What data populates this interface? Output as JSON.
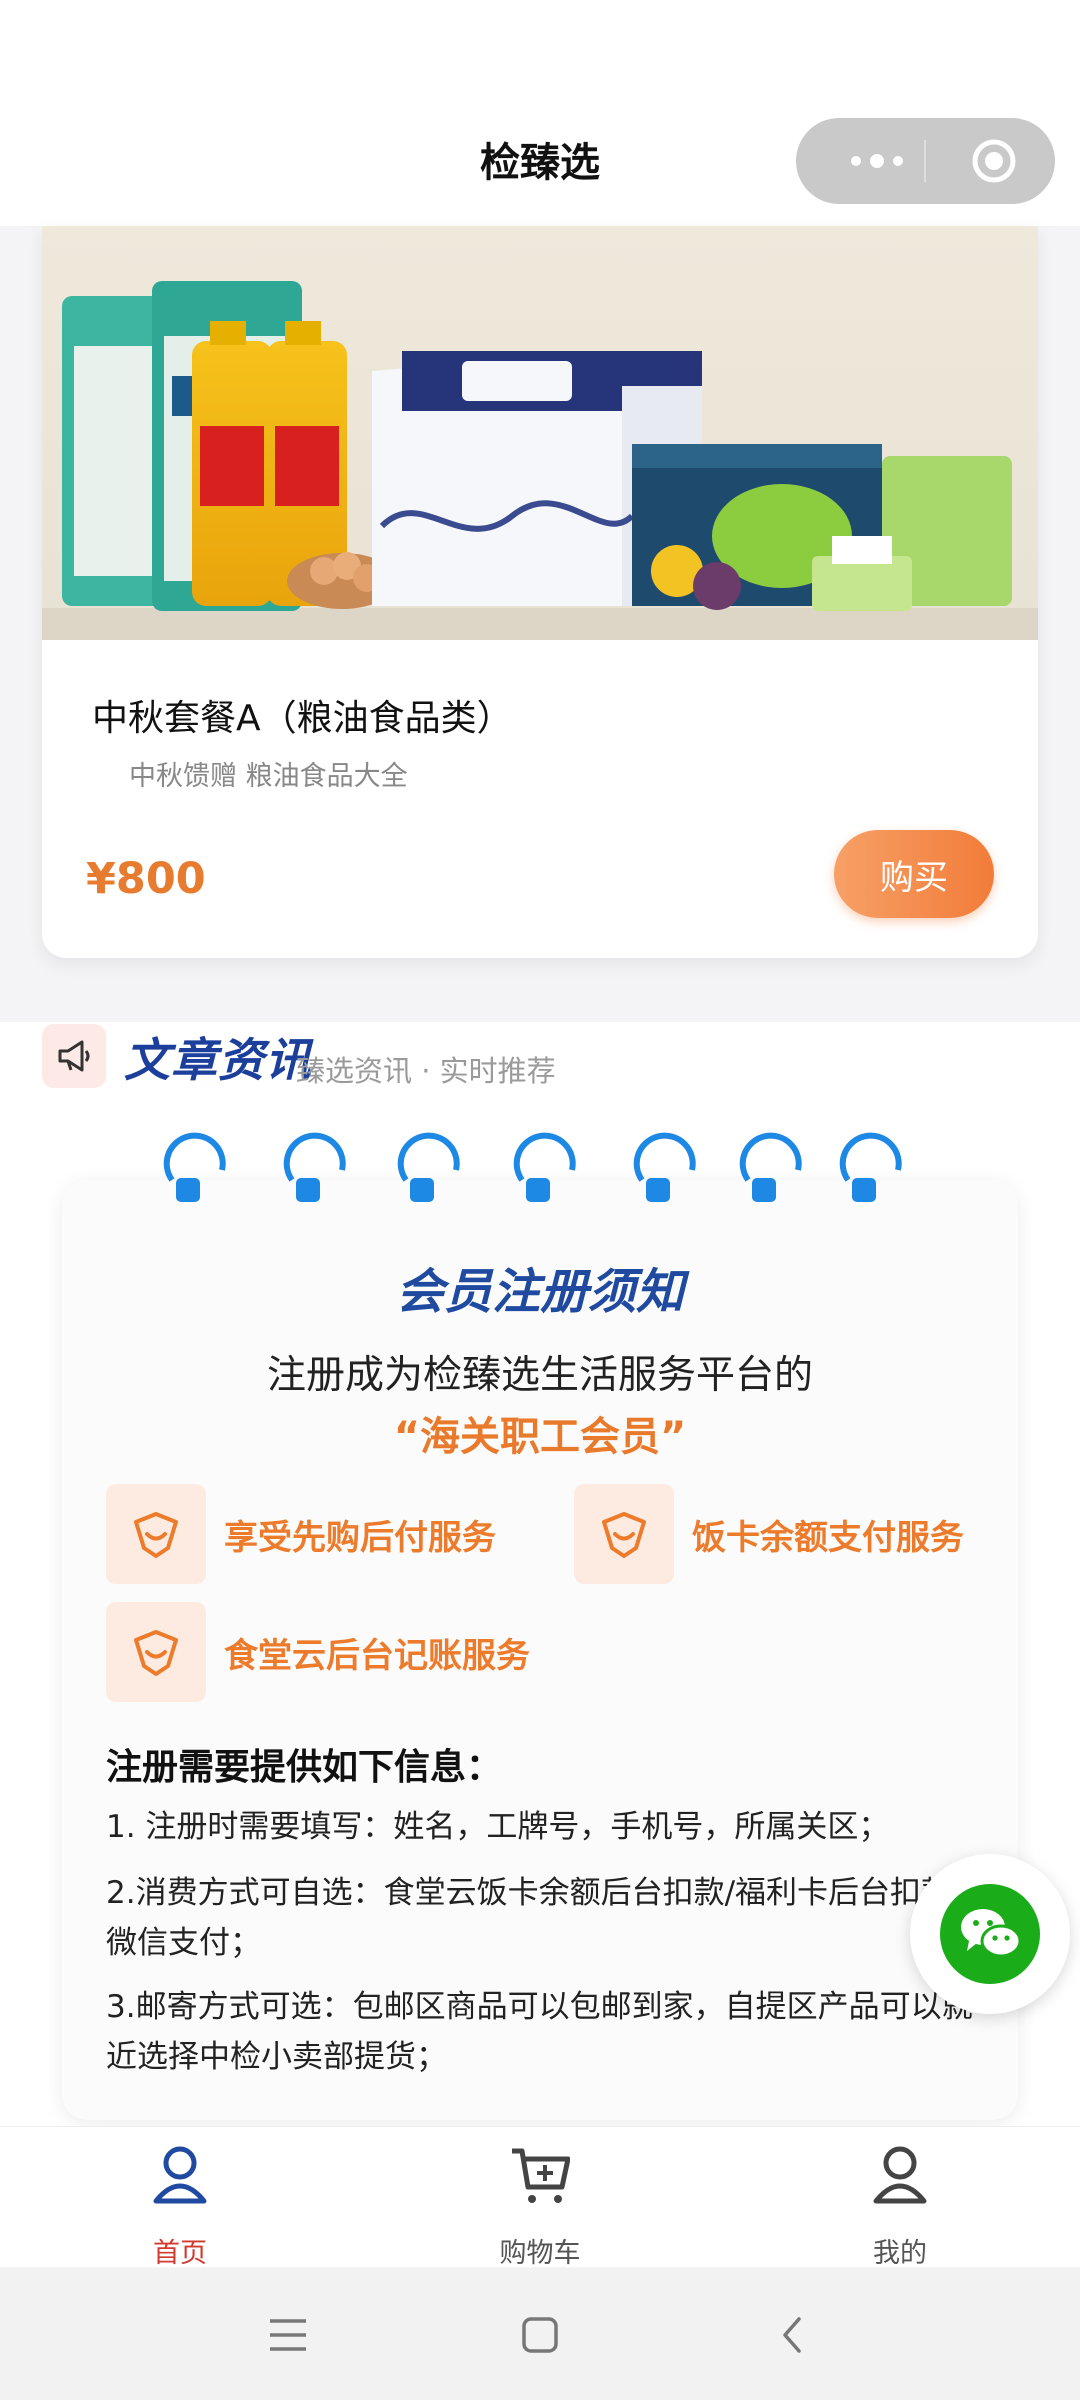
{
  "header": {
    "title": "检臻选",
    "capsule": {
      "more_icon": "more-dots-icon",
      "close_icon": "target-close-icon"
    }
  },
  "product": {
    "name": "中秋套餐A（粮油食品类）",
    "subtitle": "中秋馈赠 粮油食品大全",
    "price": "¥800",
    "buy_label": "购买"
  },
  "articles": {
    "title": "文章资讯",
    "subtitle": "臻选资讯 · 实时推荐",
    "icon": "megaphone-icon"
  },
  "notice": {
    "title": "会员注册须知",
    "line1": "注册成为检臻选生活服务平台的",
    "line2": "“海关职工会员”",
    "benefits": [
      {
        "label": "享受先购后付服务",
        "icon": "heart-shield-icon"
      },
      {
        "label": "饭卡余额支付服务",
        "icon": "heart-shield-icon"
      },
      {
        "label": "食堂云后台记账服务",
        "icon": "heart-shield-icon"
      }
    ],
    "requirements_title": "注册需要提供如下信息：",
    "requirements": [
      "1. 注册时需要填写：姓名，工牌号，手机号，所属关区；",
      "2.消费方式可自选：食堂云饭卡余额后台扣款/福利卡后台扣款/微信支付；",
      "3.邮寄方式可选：包邮区商品可以包邮到家，自提区产品可以就近选择中检小卖部提货；"
    ]
  },
  "tabbar": {
    "tabs": [
      {
        "label": "首页",
        "icon": "home-person-icon",
        "active": true
      },
      {
        "label": "购物车",
        "icon": "cart-icon",
        "active": false
      },
      {
        "label": "我的",
        "icon": "profile-icon",
        "active": false
      }
    ]
  },
  "colors": {
    "accent_orange": "#ec7b2c",
    "brand_blue": "#1f4aa0",
    "active_tab": "#d13b2e",
    "wechat_green": "#1aad19"
  }
}
